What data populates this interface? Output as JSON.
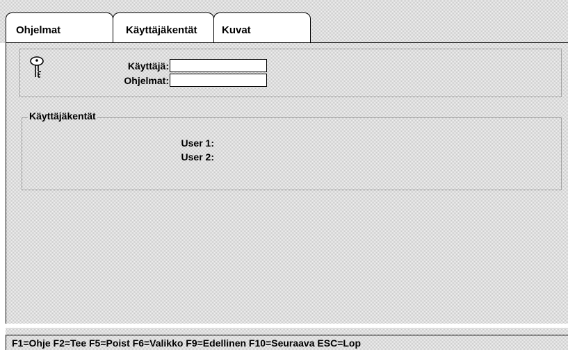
{
  "tabs": [
    {
      "label": "Ohjelmat"
    },
    {
      "label": "Käyttäjäkentät"
    },
    {
      "label": "Kuvat"
    }
  ],
  "active_tab": "Käyttäjäkentät",
  "user_section": {
    "icon": "key-icon",
    "user_label": "Käyttäjä:",
    "user_value": "",
    "programs_label": "Ohjelmat:",
    "programs_value": ""
  },
  "fields_section": {
    "title": "Käyttäjäkentät",
    "user1_label": "User 1:",
    "user2_label": "User 2:"
  },
  "status_bar": {
    "keys": "F1=Ohje  F2=Tee  F5=Poist  F6=Valikko  F9=Edellinen  F10=Seuraava  ESC=Lop"
  }
}
